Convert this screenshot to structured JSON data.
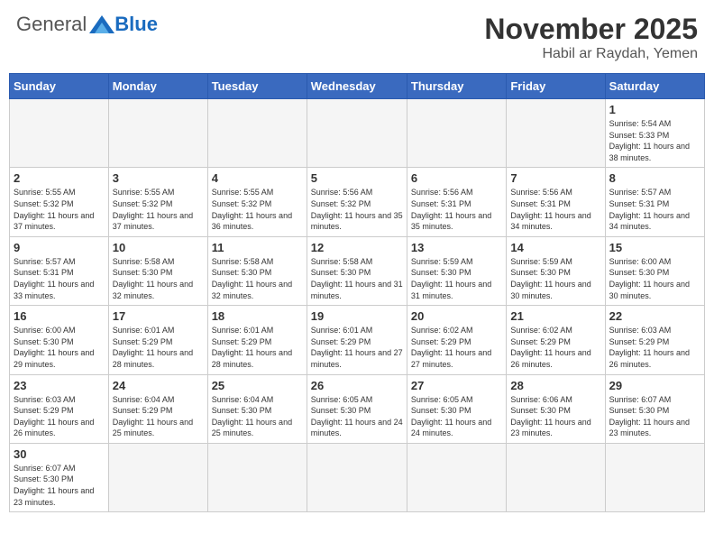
{
  "logo": {
    "general": "General",
    "blue": "Blue"
  },
  "title": "November 2025",
  "location": "Habil ar Raydah, Yemen",
  "weekdays": [
    "Sunday",
    "Monday",
    "Tuesday",
    "Wednesday",
    "Thursday",
    "Friday",
    "Saturday"
  ],
  "days": [
    {
      "num": "",
      "sunrise": "",
      "sunset": "",
      "daylight": ""
    },
    {
      "num": "",
      "sunrise": "",
      "sunset": "",
      "daylight": ""
    },
    {
      "num": "",
      "sunrise": "",
      "sunset": "",
      "daylight": ""
    },
    {
      "num": "",
      "sunrise": "",
      "sunset": "",
      "daylight": ""
    },
    {
      "num": "",
      "sunrise": "",
      "sunset": "",
      "daylight": ""
    },
    {
      "num": "",
      "sunrise": "",
      "sunset": "",
      "daylight": ""
    },
    {
      "num": "1",
      "sunrise": "Sunrise: 5:54 AM",
      "sunset": "Sunset: 5:33 PM",
      "daylight": "Daylight: 11 hours and 38 minutes."
    },
    {
      "num": "2",
      "sunrise": "Sunrise: 5:55 AM",
      "sunset": "Sunset: 5:32 PM",
      "daylight": "Daylight: 11 hours and 37 minutes."
    },
    {
      "num": "3",
      "sunrise": "Sunrise: 5:55 AM",
      "sunset": "Sunset: 5:32 PM",
      "daylight": "Daylight: 11 hours and 37 minutes."
    },
    {
      "num": "4",
      "sunrise": "Sunrise: 5:55 AM",
      "sunset": "Sunset: 5:32 PM",
      "daylight": "Daylight: 11 hours and 36 minutes."
    },
    {
      "num": "5",
      "sunrise": "Sunrise: 5:56 AM",
      "sunset": "Sunset: 5:32 PM",
      "daylight": "Daylight: 11 hours and 35 minutes."
    },
    {
      "num": "6",
      "sunrise": "Sunrise: 5:56 AM",
      "sunset": "Sunset: 5:31 PM",
      "daylight": "Daylight: 11 hours and 35 minutes."
    },
    {
      "num": "7",
      "sunrise": "Sunrise: 5:56 AM",
      "sunset": "Sunset: 5:31 PM",
      "daylight": "Daylight: 11 hours and 34 minutes."
    },
    {
      "num": "8",
      "sunrise": "Sunrise: 5:57 AM",
      "sunset": "Sunset: 5:31 PM",
      "daylight": "Daylight: 11 hours and 34 minutes."
    },
    {
      "num": "9",
      "sunrise": "Sunrise: 5:57 AM",
      "sunset": "Sunset: 5:31 PM",
      "daylight": "Daylight: 11 hours and 33 minutes."
    },
    {
      "num": "10",
      "sunrise": "Sunrise: 5:58 AM",
      "sunset": "Sunset: 5:30 PM",
      "daylight": "Daylight: 11 hours and 32 minutes."
    },
    {
      "num": "11",
      "sunrise": "Sunrise: 5:58 AM",
      "sunset": "Sunset: 5:30 PM",
      "daylight": "Daylight: 11 hours and 32 minutes."
    },
    {
      "num": "12",
      "sunrise": "Sunrise: 5:58 AM",
      "sunset": "Sunset: 5:30 PM",
      "daylight": "Daylight: 11 hours and 31 minutes."
    },
    {
      "num": "13",
      "sunrise": "Sunrise: 5:59 AM",
      "sunset": "Sunset: 5:30 PM",
      "daylight": "Daylight: 11 hours and 31 minutes."
    },
    {
      "num": "14",
      "sunrise": "Sunrise: 5:59 AM",
      "sunset": "Sunset: 5:30 PM",
      "daylight": "Daylight: 11 hours and 30 minutes."
    },
    {
      "num": "15",
      "sunrise": "Sunrise: 6:00 AM",
      "sunset": "Sunset: 5:30 PM",
      "daylight": "Daylight: 11 hours and 30 minutes."
    },
    {
      "num": "16",
      "sunrise": "Sunrise: 6:00 AM",
      "sunset": "Sunset: 5:30 PM",
      "daylight": "Daylight: 11 hours and 29 minutes."
    },
    {
      "num": "17",
      "sunrise": "Sunrise: 6:01 AM",
      "sunset": "Sunset: 5:29 PM",
      "daylight": "Daylight: 11 hours and 28 minutes."
    },
    {
      "num": "18",
      "sunrise": "Sunrise: 6:01 AM",
      "sunset": "Sunset: 5:29 PM",
      "daylight": "Daylight: 11 hours and 28 minutes."
    },
    {
      "num": "19",
      "sunrise": "Sunrise: 6:01 AM",
      "sunset": "Sunset: 5:29 PM",
      "daylight": "Daylight: 11 hours and 27 minutes."
    },
    {
      "num": "20",
      "sunrise": "Sunrise: 6:02 AM",
      "sunset": "Sunset: 5:29 PM",
      "daylight": "Daylight: 11 hours and 27 minutes."
    },
    {
      "num": "21",
      "sunrise": "Sunrise: 6:02 AM",
      "sunset": "Sunset: 5:29 PM",
      "daylight": "Daylight: 11 hours and 26 minutes."
    },
    {
      "num": "22",
      "sunrise": "Sunrise: 6:03 AM",
      "sunset": "Sunset: 5:29 PM",
      "daylight": "Daylight: 11 hours and 26 minutes."
    },
    {
      "num": "23",
      "sunrise": "Sunrise: 6:03 AM",
      "sunset": "Sunset: 5:29 PM",
      "daylight": "Daylight: 11 hours and 26 minutes."
    },
    {
      "num": "24",
      "sunrise": "Sunrise: 6:04 AM",
      "sunset": "Sunset: 5:29 PM",
      "daylight": "Daylight: 11 hours and 25 minutes."
    },
    {
      "num": "25",
      "sunrise": "Sunrise: 6:04 AM",
      "sunset": "Sunset: 5:30 PM",
      "daylight": "Daylight: 11 hours and 25 minutes."
    },
    {
      "num": "26",
      "sunrise": "Sunrise: 6:05 AM",
      "sunset": "Sunset: 5:30 PM",
      "daylight": "Daylight: 11 hours and 24 minutes."
    },
    {
      "num": "27",
      "sunrise": "Sunrise: 6:05 AM",
      "sunset": "Sunset: 5:30 PM",
      "daylight": "Daylight: 11 hours and 24 minutes."
    },
    {
      "num": "28",
      "sunrise": "Sunrise: 6:06 AM",
      "sunset": "Sunset: 5:30 PM",
      "daylight": "Daylight: 11 hours and 23 minutes."
    },
    {
      "num": "29",
      "sunrise": "Sunrise: 6:07 AM",
      "sunset": "Sunset: 5:30 PM",
      "daylight": "Daylight: 11 hours and 23 minutes."
    },
    {
      "num": "30",
      "sunrise": "Sunrise: 6:07 AM",
      "sunset": "Sunset: 5:30 PM",
      "daylight": "Daylight: 11 hours and 23 minutes."
    }
  ]
}
